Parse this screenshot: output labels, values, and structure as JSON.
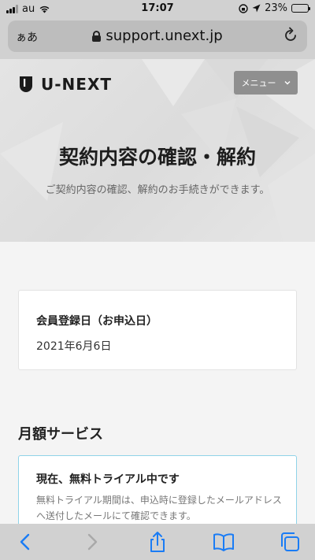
{
  "status_bar": {
    "carrier": "au",
    "time": "17:07",
    "battery": "23%",
    "battery_level": 0.23
  },
  "browser": {
    "text_size_button": "ぁあ",
    "url": "support.unext.jp",
    "icons": [
      "lock-icon",
      "reload-icon",
      "back-icon",
      "forward-icon",
      "share-icon",
      "bookmarks-icon",
      "tabs-icon"
    ]
  },
  "header": {
    "logo_text": "U-NEXT",
    "menu_label": "メニュー"
  },
  "hero": {
    "title": "契約内容の確認・解約",
    "subtitle": "ご契約内容の確認、解約のお手続きができます。"
  },
  "registration": {
    "label": "会員登録日（お申込日）",
    "value": "2021年6月6日"
  },
  "monthly": {
    "section_title": "月額サービス",
    "status_title": "現在、無料トライアル中です",
    "description": "無料トライアル期間は、申込時に登録したメールアドレスへ送付したメールにて確認できます。"
  },
  "colors": {
    "accent_border": "#8fd3e8",
    "browser_chrome": "#d1d1d1",
    "toolbar_blue": "#1a7cf5"
  }
}
